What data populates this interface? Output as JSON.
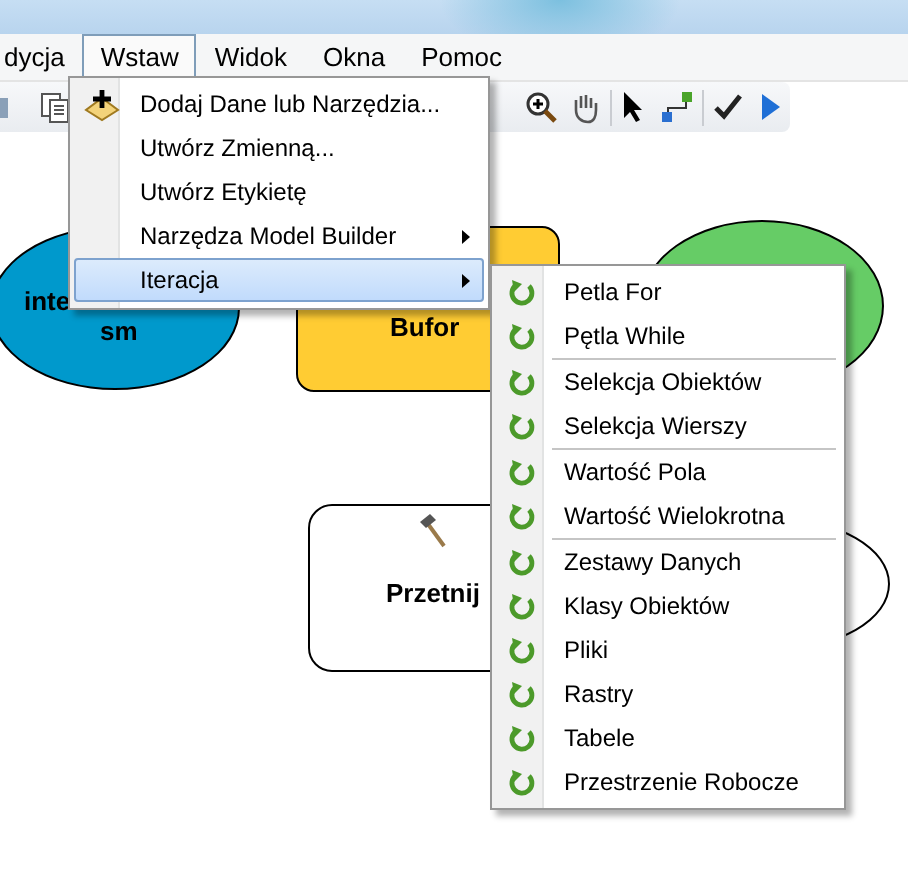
{
  "menu_bar": [
    {
      "label": "dycja",
      "selected": false
    },
    {
      "label": "Wstaw",
      "selected": true
    },
    {
      "label": "Widok",
      "selected": false
    },
    {
      "label": "Okna",
      "selected": false
    },
    {
      "label": "Pomoc",
      "selected": false
    }
  ],
  "insert_menu": {
    "items": [
      {
        "label": "Dodaj Dane lub Narzędzia...",
        "kind": "add",
        "selected": false
      },
      {
        "label": "Utwórz Zmienną...",
        "kind": "plain",
        "selected": false
      },
      {
        "label": "Utwórz Etykietę",
        "kind": "plain",
        "selected": false
      },
      {
        "label": "Narzędza Model Builder",
        "kind": "submenu",
        "selected": false
      },
      {
        "label": "Iteracja",
        "kind": "submenu",
        "selected": true
      }
    ]
  },
  "iteration_submenu": {
    "groups": [
      {
        "items": [
          "Petla For",
          "Pętla While"
        ]
      },
      {
        "items": [
          "Selekcja Obiektów",
          "Selekcja Wierszy"
        ]
      },
      {
        "items": [
          "Wartość Pola",
          "Wartość Wielokrotna"
        ]
      },
      {
        "items": [
          "Zestawy Danych",
          "Klasy Obiektów",
          "Pliki",
          "Rastry",
          "Tabele",
          "Przestrzenie Robocze"
        ]
      }
    ]
  },
  "diagram": {
    "nodes": [
      {
        "kind": "ellipse",
        "color": "#0099cc",
        "texts": [
          "inte",
          "sm"
        ]
      },
      {
        "kind": "rect",
        "color": "#ffcc33",
        "texts": [
          "Bufor"
        ]
      },
      {
        "kind": "ellipse",
        "color": "#66cc66"
      },
      {
        "kind": "tool",
        "color": "#ffffff",
        "texts": [
          "Przetnij"
        ]
      },
      {
        "kind": "ellipse",
        "color": "#ffffff"
      }
    ]
  }
}
